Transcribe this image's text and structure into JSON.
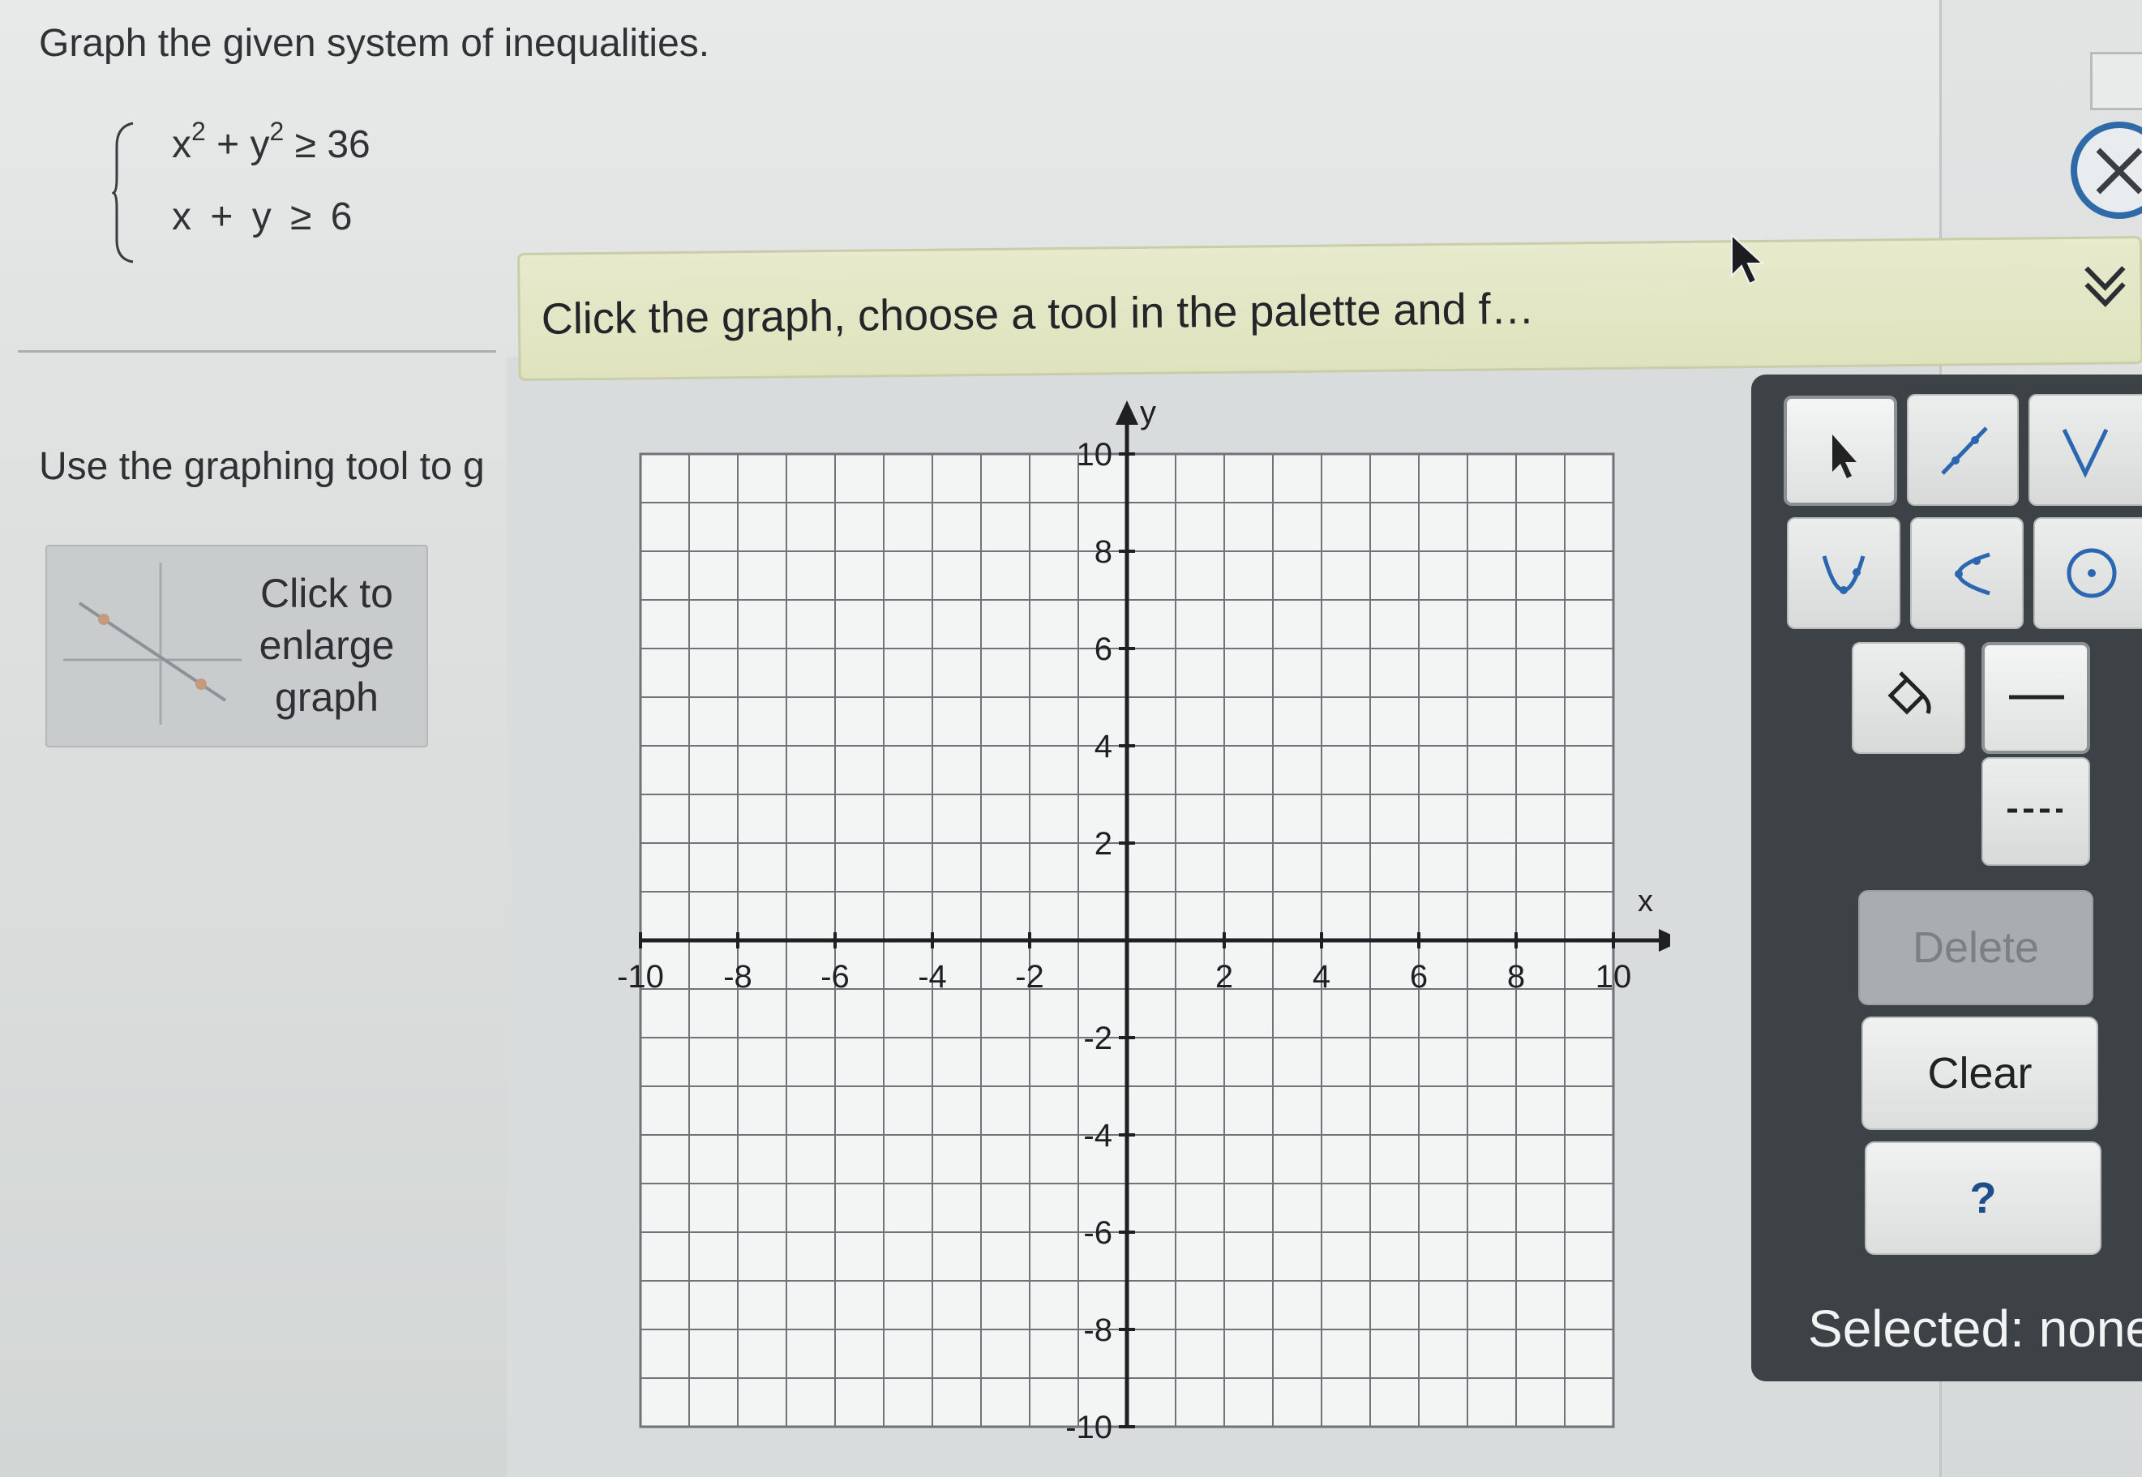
{
  "question": {
    "title": "Graph the given system of inequalities.",
    "equations": [
      {
        "parts": [
          "x",
          "2",
          " + y",
          "2",
          " ≥ 36"
        ]
      },
      {
        "text": "x  + y  ≥  6"
      }
    ],
    "instruction": "Use the graphing tool to g",
    "thumbnail": {
      "lines": [
        "Click to",
        "enlarge",
        "graph"
      ]
    }
  },
  "hint_bar": {
    "text": "Click the graph, choose a tool in the palette and f…"
  },
  "graph": {
    "x_label": "x",
    "y_label": "y",
    "x_range": [
      -10,
      10
    ],
    "y_range": [
      -10,
      10
    ],
    "minor_step": 1,
    "x_tick_labels": [
      "-10",
      "-8",
      "-6",
      "-4",
      "-2",
      "2",
      "4",
      "6",
      "8",
      "10"
    ],
    "y_tick_labels": [
      "10",
      "8",
      "6",
      "4",
      "2",
      "-2",
      "-4",
      "-6",
      "-8",
      "-10"
    ]
  },
  "palette": {
    "tools": [
      {
        "name": "pointer-tool",
        "icon": "arrow-pointer-icon"
      },
      {
        "name": "line-tool",
        "icon": "line-segment-icon"
      },
      {
        "name": "absolute-value-tool",
        "icon": "v-shape-icon"
      },
      {
        "name": "parabola-tool",
        "icon": "parabola-icon"
      },
      {
        "name": "sideways-parabola-tool",
        "icon": "sideways-parabola-icon"
      },
      {
        "name": "circle-tool",
        "icon": "circle-icon"
      },
      {
        "name": "fill-tool",
        "icon": "paint-bucket-icon"
      },
      {
        "name": "solid-line-style",
        "icon": "solid-line-icon"
      },
      {
        "name": "dashed-line-style",
        "icon": "dashed-line-icon"
      }
    ],
    "delete_label": "Delete",
    "clear_label": "Clear",
    "help_label": "?",
    "selected_text": "Selected: none"
  },
  "colors": {
    "accent": "#1e5a9c",
    "palette_bg": "#3d4247",
    "hint_bg": "#e2e6c4"
  }
}
